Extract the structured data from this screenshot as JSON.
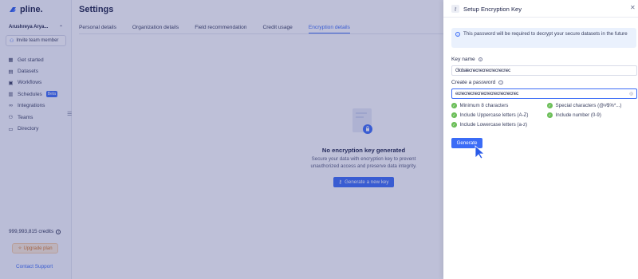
{
  "sidebar": {
    "logo_text": "pline.",
    "workspace": "Arushreya Arya...",
    "invite_label": "Invite team member",
    "items": [
      {
        "label": "Get started",
        "icon": "grid-icon"
      },
      {
        "label": "Datasets",
        "icon": "dataset-icon"
      },
      {
        "label": "Workflows",
        "icon": "workflow-icon"
      },
      {
        "label": "Schedules",
        "icon": "schedule-icon",
        "badge": "Beta"
      },
      {
        "label": "Integrations",
        "icon": "link-icon"
      },
      {
        "label": "Teams",
        "icon": "teams-icon"
      },
      {
        "label": "Directory",
        "icon": "folder-icon"
      }
    ],
    "credits": "999,993,815 credits",
    "upgrade_label": "Upgrade plan",
    "contact_label": "Contact Support"
  },
  "main": {
    "title": "Settings",
    "tabs": [
      {
        "label": "Personal details",
        "active": false
      },
      {
        "label": "Organization details",
        "active": false
      },
      {
        "label": "Field recommendation",
        "active": false
      },
      {
        "label": "Credit usage",
        "active": false
      },
      {
        "label": "Encryption details",
        "active": true
      }
    ],
    "empty_title": "No encryption key generated",
    "empty_desc": "Secure your data with encryption key to prevent unauthorized access and preserve data integrity.",
    "generate_new_label": "Generate a new key"
  },
  "drawer": {
    "title": "Setup Encryption Key",
    "info": "This password will be required to decrypt your secure datasets in the future",
    "key_name_label": "Key name",
    "key_name_value": "Globalecnecnecnecnecnecnec",
    "password_label": "Create a password",
    "password_value": "ecnecnecnecnecnecnecnecnecnec",
    "rules": [
      "Minimum 8 characters",
      "Special characters (@#$%*...)",
      "Include Uppercase letters (A-Z)",
      "Include number (0-9)",
      "Include Lowercase letters (a-z)"
    ],
    "generate_label": "Generate"
  },
  "colors": {
    "accent": "#3b6cf6",
    "success": "#6dbf5a",
    "overlay": "#343c86"
  }
}
